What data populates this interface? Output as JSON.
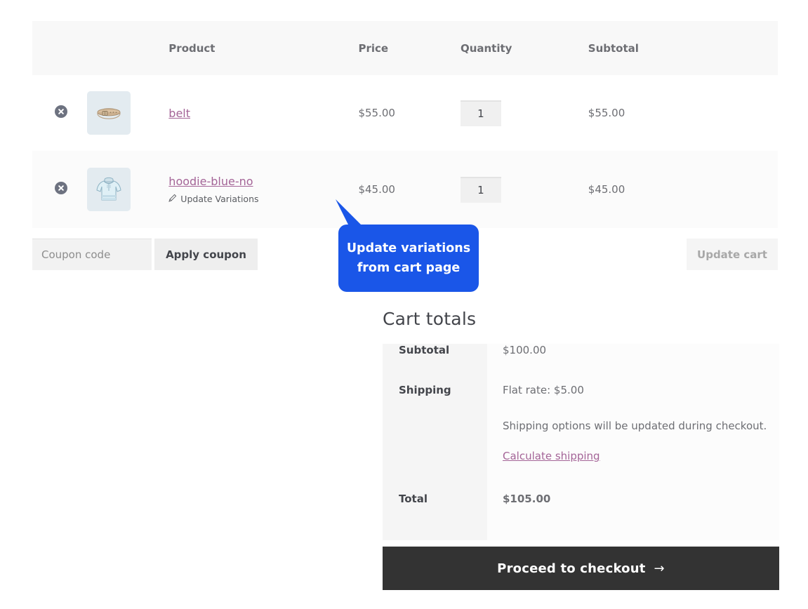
{
  "cart_table": {
    "columns": [
      "",
      "",
      "Product",
      "Price",
      "Quantity",
      "Subtotal"
    ],
    "headers": {
      "product": "Product",
      "price": "Price",
      "quantity": "Quantity",
      "subtotal": "Subtotal"
    },
    "rows": [
      {
        "remove_icon": "remove-circle-x-icon",
        "thumbnail_icon": "belt-product-thumbnail",
        "name": "belt",
        "price": "$55.00",
        "quantity": "1",
        "subtotal": "$55.00"
      },
      {
        "remove_icon": "remove-circle-x-icon",
        "thumbnail_icon": "hoodie-product-thumbnail",
        "name": "hoodie-blue-no",
        "variation_action": "Update Variations",
        "variation_icon": "pencil-icon",
        "price": "$45.00",
        "quantity": "1",
        "subtotal": "$45.00"
      }
    ]
  },
  "coupon": {
    "placeholder": "Coupon code",
    "value": "",
    "apply_label": "Apply coupon",
    "update_cart_label": "Update cart"
  },
  "callout": {
    "line1": "Update variations",
    "line2": "from cart page",
    "color": "#1a56e8"
  },
  "totals": {
    "title": "Cart totals",
    "subtotal_label": "Subtotal",
    "subtotal_value": "$100.00",
    "shipping_label": "Shipping",
    "shipping_rate": "Flat rate: $5.00",
    "shipping_note": "Shipping options will be updated during checkout.",
    "calculate_link": "Calculate shipping",
    "total_label": "Total",
    "total_value": "$105.00"
  },
  "checkout": {
    "label": "Proceed to checkout",
    "arrow": "→"
  },
  "theme": {
    "link_color": "#a46497",
    "header_bg": "#f8f8f8",
    "checkout_bg": "#333333"
  }
}
